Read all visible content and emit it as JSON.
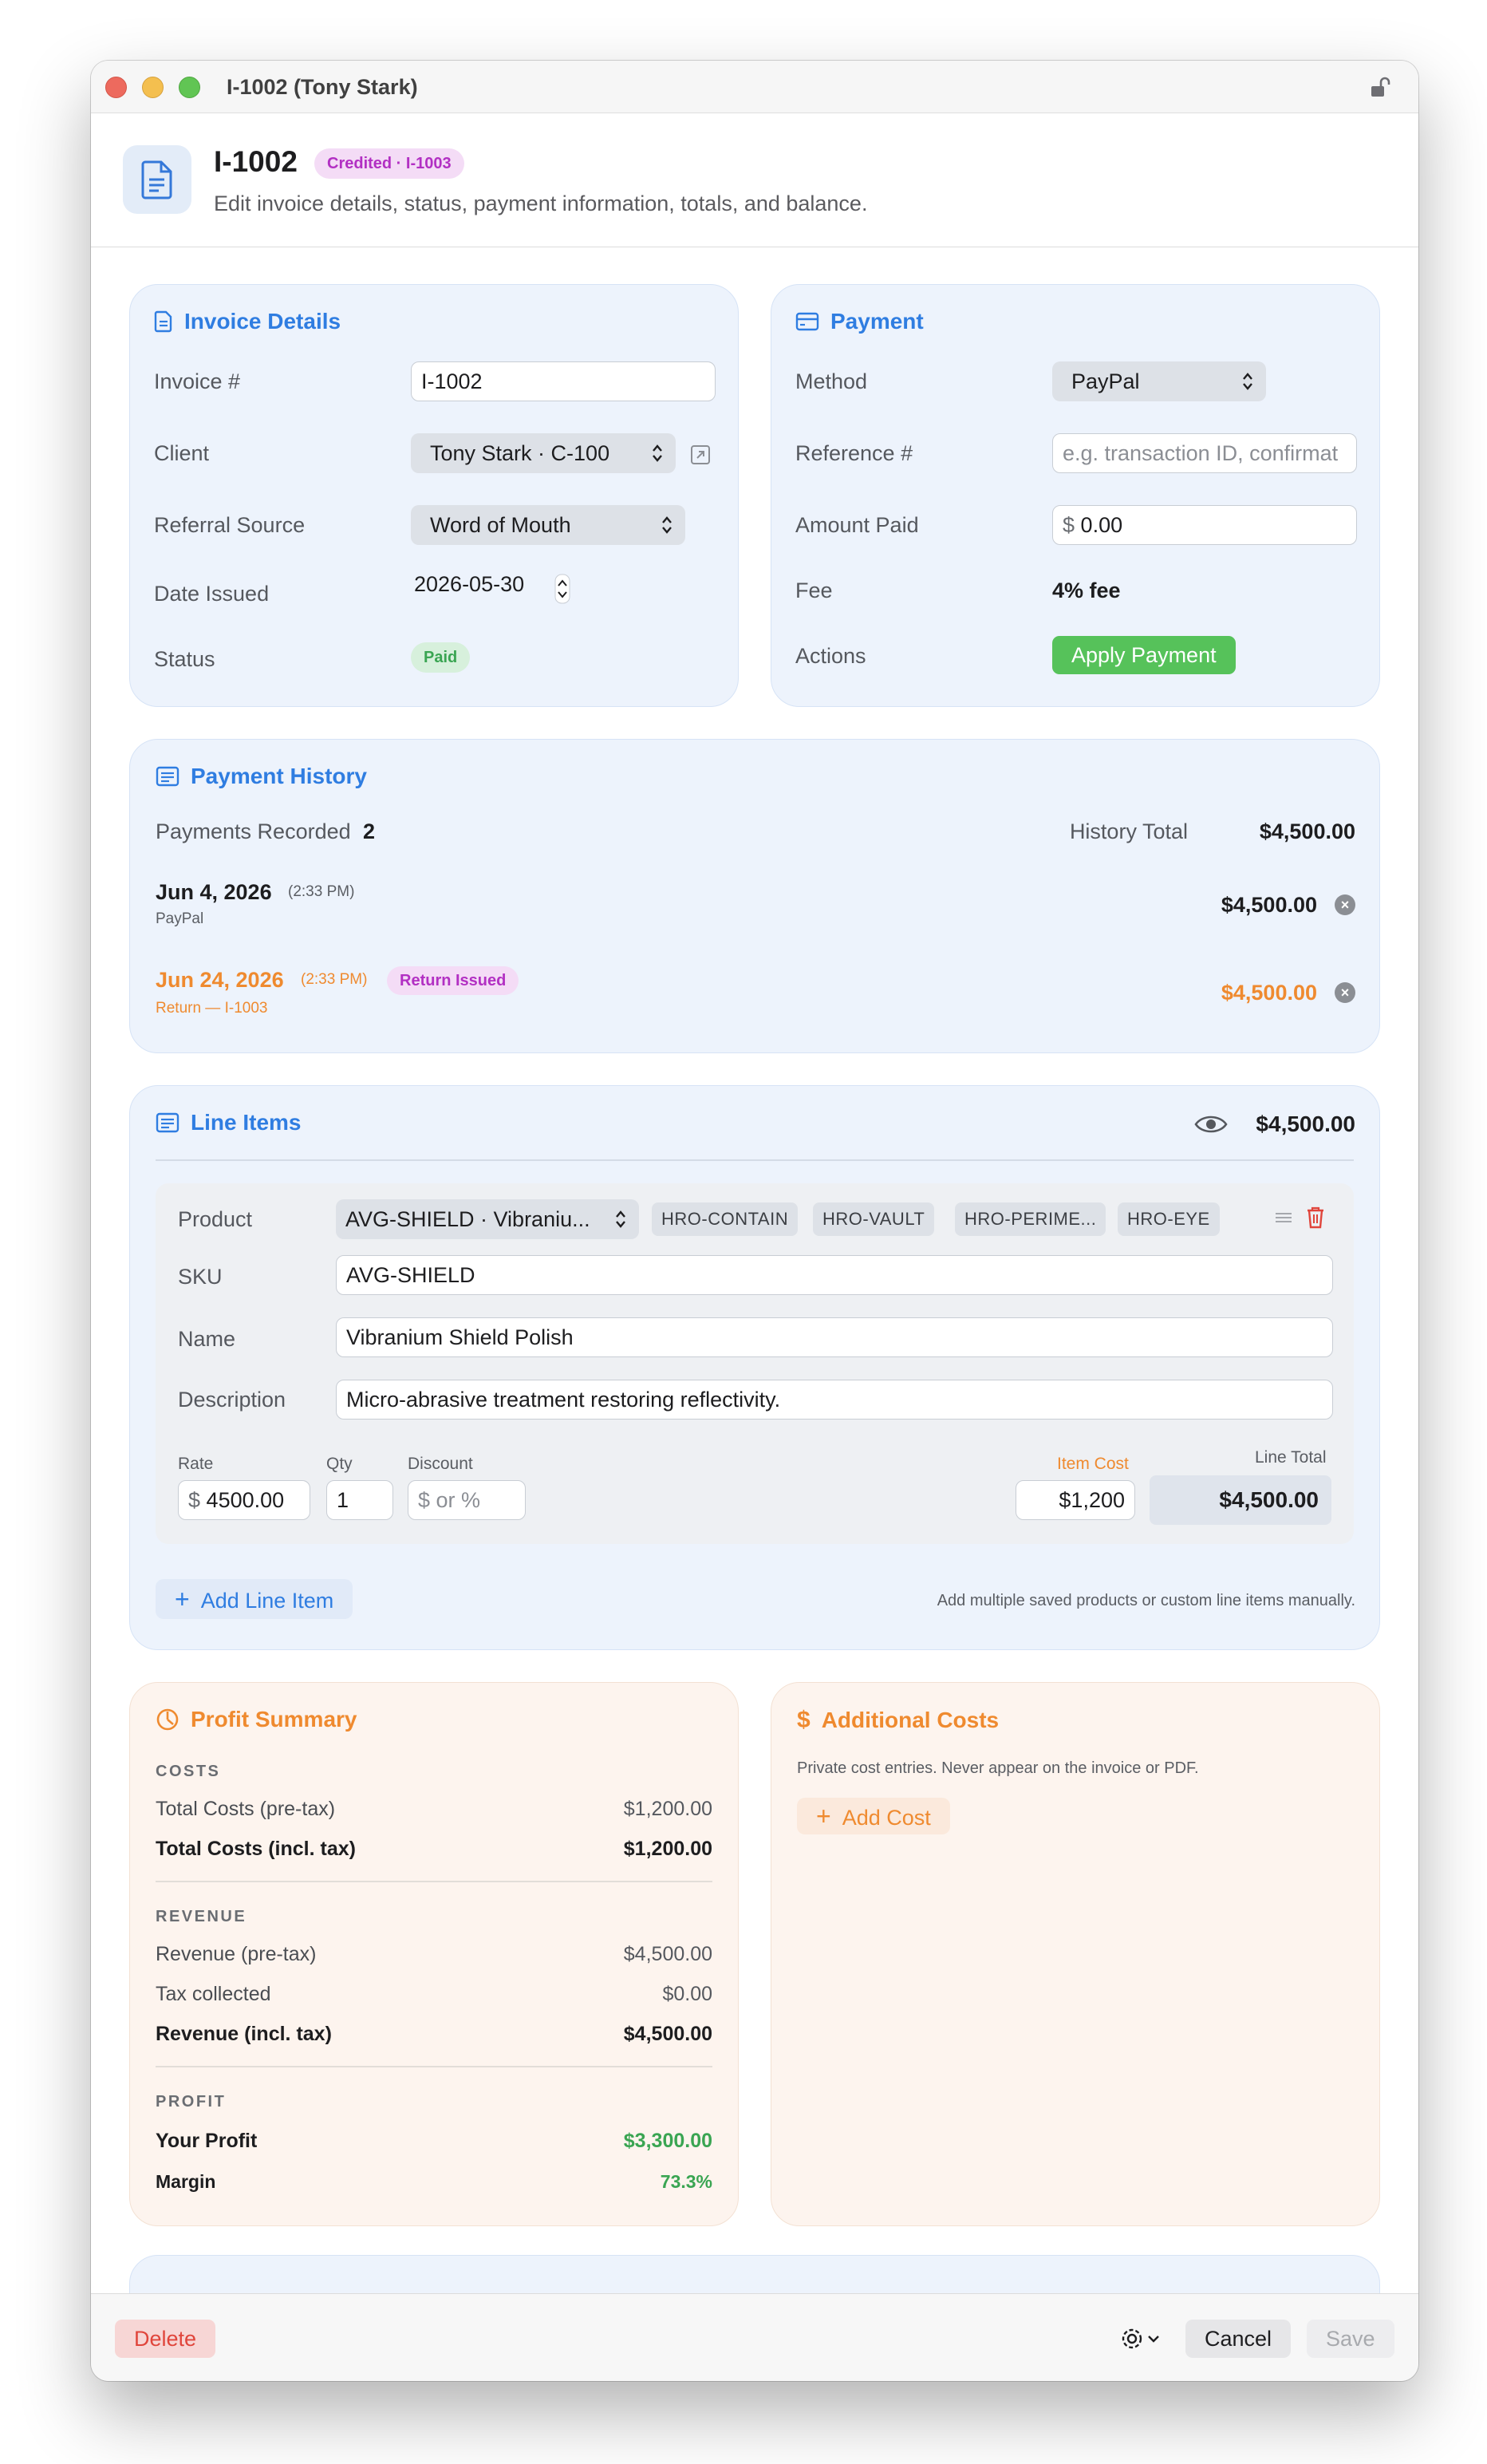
{
  "window": {
    "title": "I-1002 (Tony Stark)"
  },
  "header": {
    "invoice_id": "I-1002",
    "badge": "Credited · I-1003",
    "subtitle": "Edit invoice details, status, payment information, totals, and balance."
  },
  "invoice_details": {
    "title": "Invoice Details",
    "invoice_label": "Invoice #",
    "invoice_value": "I-1002",
    "client_label": "Client",
    "client_value": "Tony Stark · C-100",
    "referral_label": "Referral Source",
    "referral_value": "Word of Mouth",
    "date_label": "Date Issued",
    "date_value": "2026-05-30",
    "status_label": "Status",
    "status_value": "Paid"
  },
  "payment": {
    "title": "Payment",
    "method_label": "Method",
    "method_value": "PayPal",
    "reference_label": "Reference #",
    "reference_placeholder": "e.g. transaction ID, confirmat",
    "amount_label": "Amount Paid",
    "amount_currency": "$",
    "amount_value": "0.00",
    "fee_label": "Fee",
    "fee_value": "4% fee",
    "actions_label": "Actions",
    "apply_button": "Apply Payment"
  },
  "payment_history": {
    "title": "Payment History",
    "recorded_label": "Payments Recorded",
    "recorded_count": "2",
    "total_label": "History Total",
    "total_value": "$4,500.00",
    "entries": [
      {
        "date": "Jun 4, 2026",
        "time": "(2:33 PM)",
        "sub": "PayPal",
        "amount": "$4,500.00"
      },
      {
        "date": "Jun 24, 2026",
        "time": "(2:33 PM)",
        "badge": "Return Issued",
        "sub": "Return — I-1003",
        "amount": "$4,500.00"
      }
    ]
  },
  "line_items": {
    "title": "Line Items",
    "total": "$4,500.00",
    "product_label": "Product",
    "product_value": "AVG-SHIELD · Vibraniu...",
    "chips": [
      "HRO-CONTAIN",
      "HRO-VAULT",
      "HRO-PERIME...",
      "HRO-EYE"
    ],
    "sku_label": "SKU",
    "sku_value": "AVG-SHIELD",
    "name_label": "Name",
    "name_value": "Vibranium Shield Polish",
    "desc_label": "Description",
    "desc_value": "Micro-abrasive treatment restoring reflectivity.",
    "rate_label": "Rate",
    "rate_currency": "$",
    "rate_value": "4500.00",
    "qty_label": "Qty",
    "qty_value": "1",
    "discount_label": "Discount",
    "discount_placeholder": "$ or %",
    "item_cost_label": "Item Cost",
    "item_cost_value": "$1,200",
    "line_total_label": "Line Total",
    "line_total_value": "$4,500.00",
    "add_button": "Add Line Item",
    "hint": "Add multiple saved products or custom line items manually."
  },
  "profit_summary": {
    "title": "Profit Summary",
    "costs_heading": "COSTS",
    "total_costs_pre_label": "Total Costs (pre-tax)",
    "total_costs_pre_value": "$1,200.00",
    "total_costs_incl_label": "Total Costs (incl. tax)",
    "total_costs_incl_value": "$1,200.00",
    "revenue_heading": "REVENUE",
    "revenue_pre_label": "Revenue (pre-tax)",
    "revenue_pre_value": "$4,500.00",
    "tax_label": "Tax collected",
    "tax_value": "$0.00",
    "revenue_incl_label": "Revenue (incl. tax)",
    "revenue_incl_value": "$4,500.00",
    "profit_heading": "PROFIT",
    "profit_label": "Your Profit",
    "profit_value": "$3,300.00",
    "margin_label": "Margin",
    "margin_value": "73.3%"
  },
  "additional_costs": {
    "title": "Additional Costs",
    "note": "Private cost entries. Never appear on the invoice or PDF.",
    "add_button": "Add Cost"
  },
  "footer": {
    "delete": "Delete",
    "cancel": "Cancel",
    "save": "Save"
  },
  "colors": {
    "accent_blue": "#2f7de1",
    "accent_orange": "#ef8a2f",
    "success_green": "#56c25a",
    "danger_red": "#e0453b",
    "credit_magenta": "#b230c3"
  }
}
